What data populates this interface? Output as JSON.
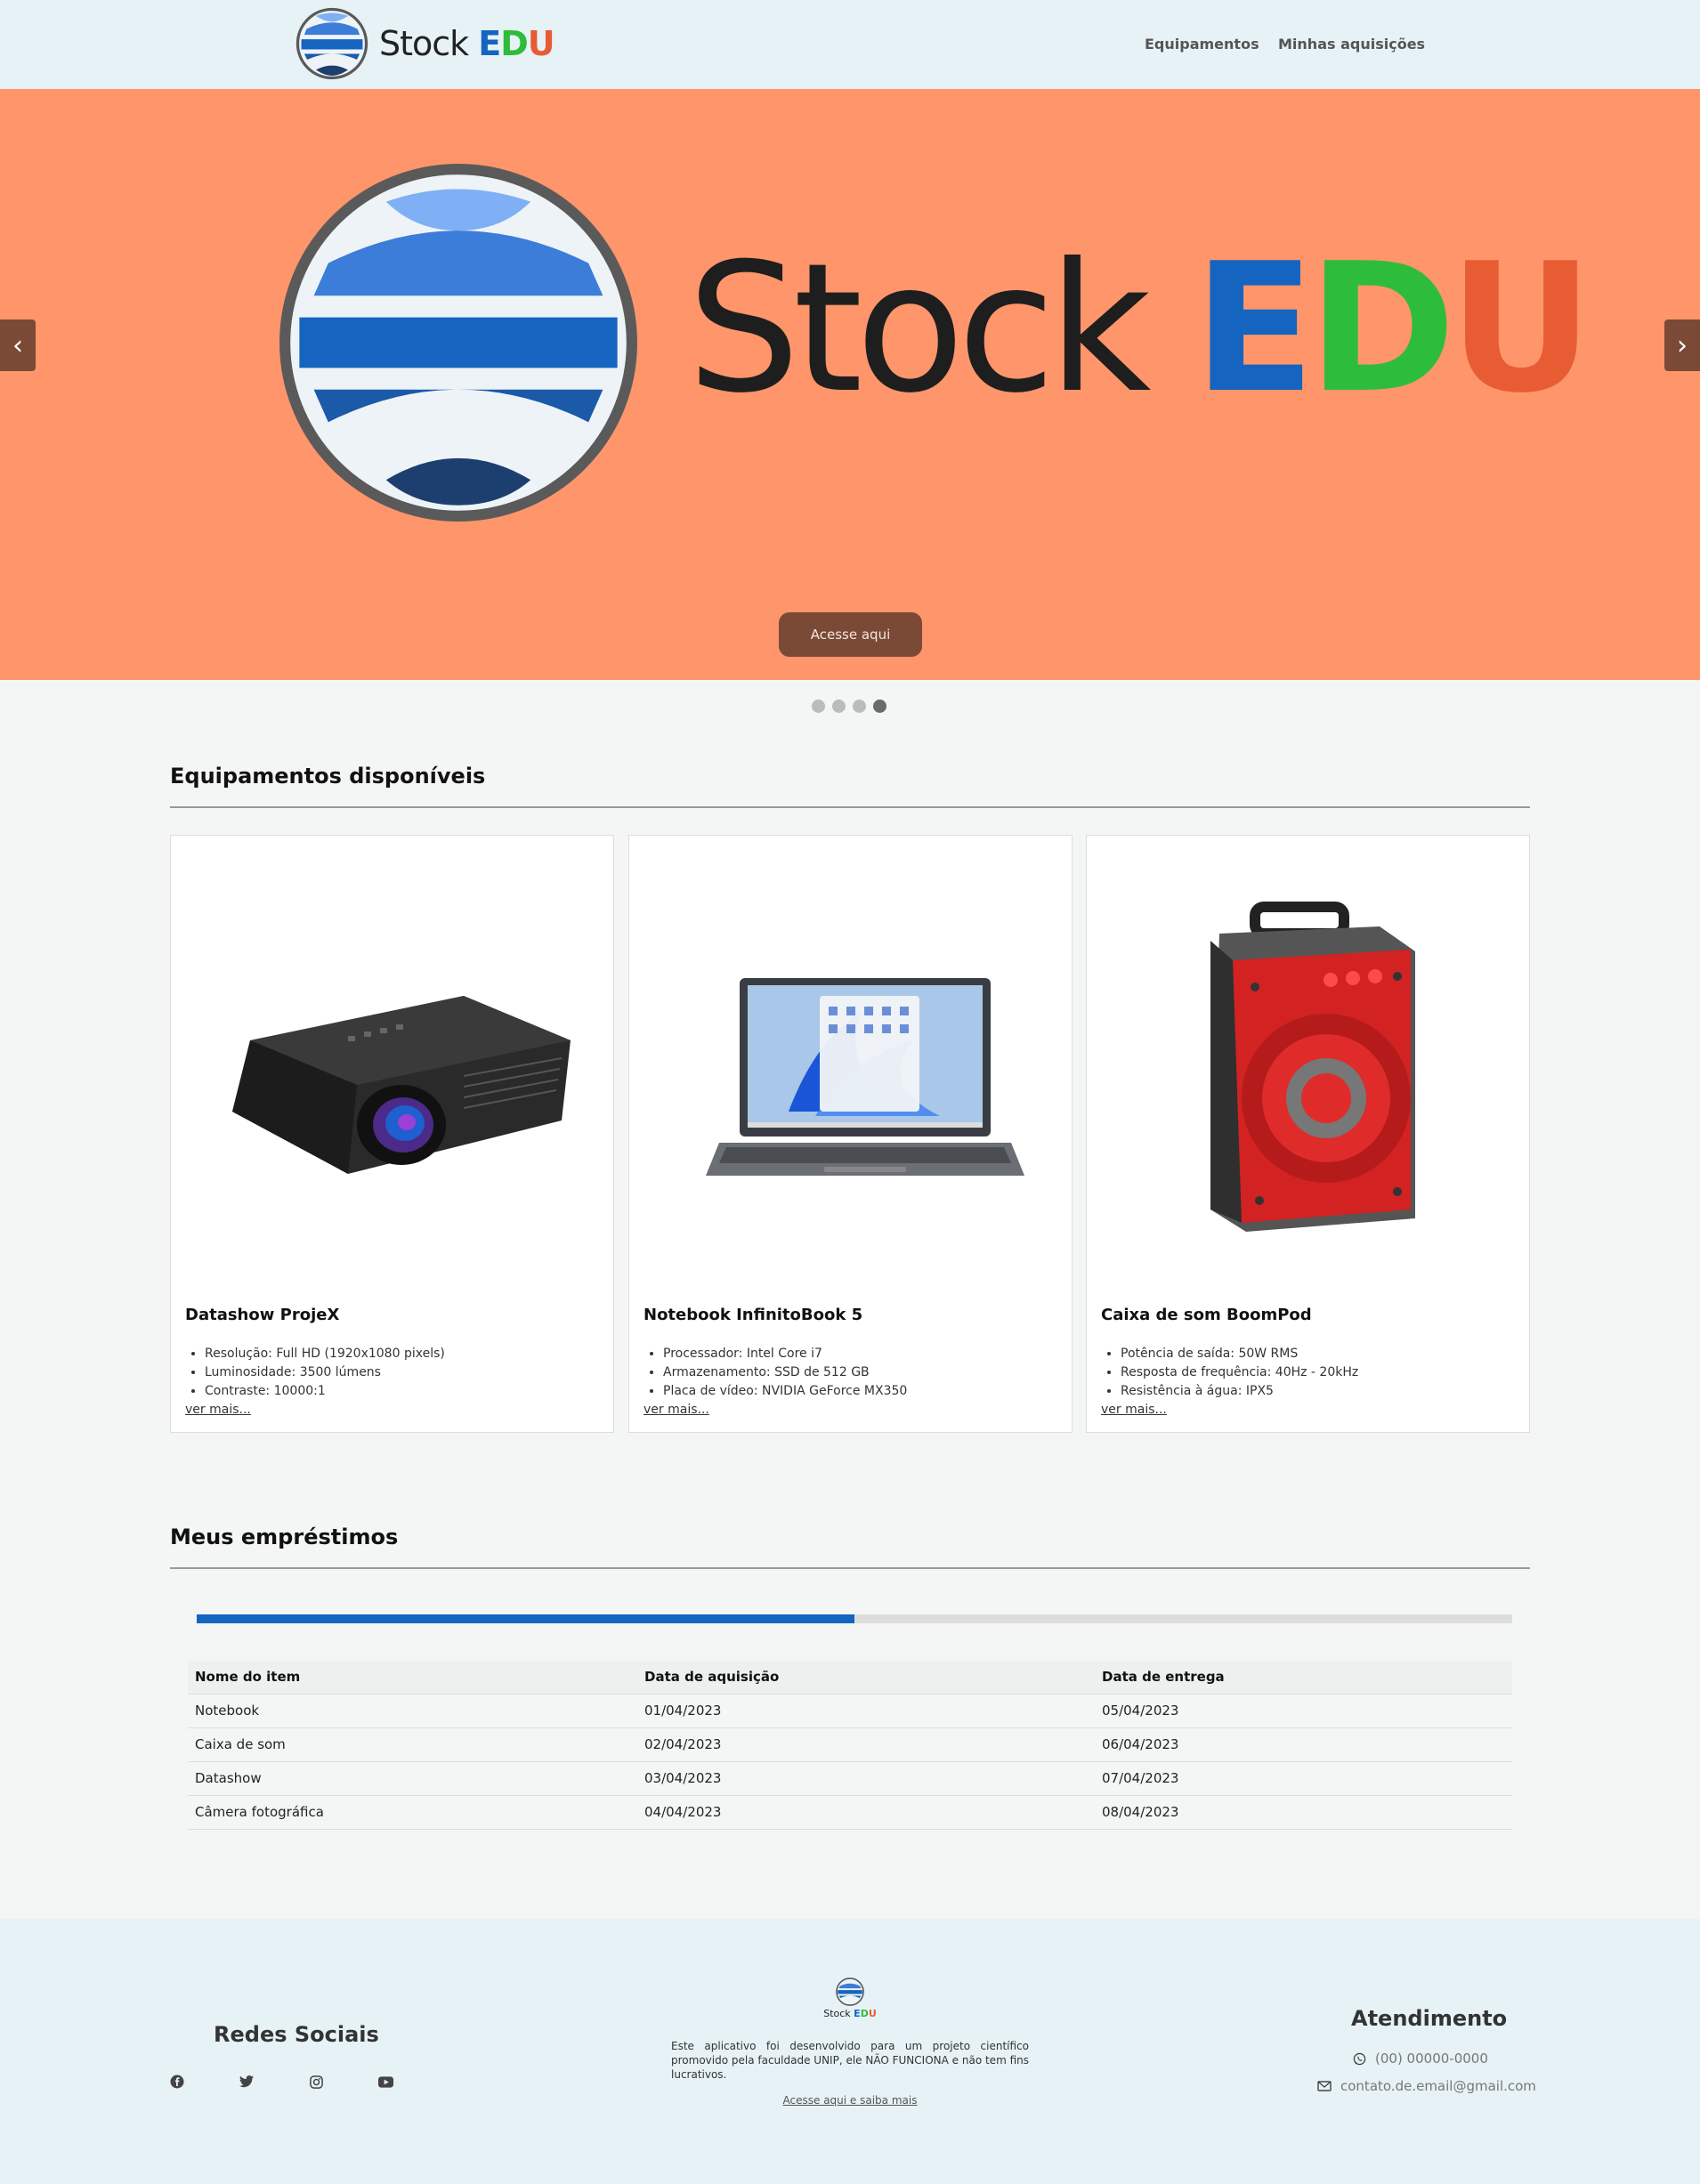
{
  "header": {
    "brand": {
      "stock": "Stock",
      "e": "E",
      "d": "D",
      "u": "U"
    },
    "nav": [
      "Equipamentos",
      "Minhas aquisições"
    ]
  },
  "hero": {
    "prev": "‹",
    "next": "›",
    "cta": "Acesse aqui",
    "slides": 4,
    "active_slide": 4
  },
  "equipamentos": {
    "title": "Equipamentos disponíveis",
    "more_label": "ver mais...",
    "cards": [
      {
        "title": "Datashow ProjeX",
        "image": "projector-image",
        "specs": [
          "Resolução: Full HD (1920x1080 pixels)",
          "Luminosidade: 3500 lúmens",
          "Contraste: 10000:1"
        ]
      },
      {
        "title": "Notebook InfinitoBook 5",
        "image": "laptop-image",
        "specs": [
          "Processador: Intel Core i7",
          "Armazenamento: SSD de 512 GB",
          "Placa de vídeo: NVIDIA GeForce MX350"
        ]
      },
      {
        "title": "Caixa de som BoomPod",
        "image": "speaker-image",
        "specs": [
          "Potência de saída: 50W RMS",
          "Resposta de frequência: 40Hz - 20kHz",
          "Resistência à água: IPX5"
        ]
      }
    ]
  },
  "emprestimos": {
    "title": "Meus empréstimos",
    "progress": 0.5,
    "columns": [
      "Nome do item",
      "Data de aquisição",
      "Data de entrega"
    ],
    "rows": [
      [
        "Notebook",
        "01/04/2023",
        "05/04/2023"
      ],
      [
        "Caixa de som",
        "02/04/2023",
        "06/04/2023"
      ],
      [
        "Datashow",
        "03/04/2023",
        "07/04/2023"
      ],
      [
        "Câmera fotográfica",
        "04/04/2023",
        "08/04/2023"
      ]
    ]
  },
  "footer": {
    "social_title": "Redes Sociais",
    "social_icons": [
      "facebook-icon",
      "twitter-icon",
      "instagram-icon",
      "youtube-icon"
    ],
    "description": "Este aplicativo foi desenvolvido para um projeto científico promovido pela faculdade UNIP, ele NÃO FUNCIONA e não tem fins lucrativos.",
    "link": "Acesse aqui e saiba mais",
    "attendance_title": "Atendimento",
    "phone": "(00) 00000-0000",
    "email": "contato.de.email@gmail.com"
  },
  "colors": {
    "primary": "#1565c0",
    "green": "#2ebd3a",
    "orange": "#e85c33",
    "hero_bg": "#ff956a",
    "button": "#7a4a36"
  }
}
